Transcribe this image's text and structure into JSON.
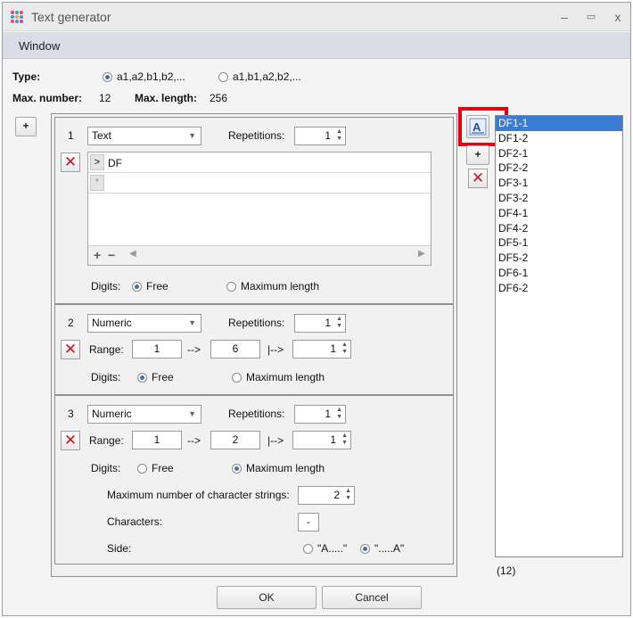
{
  "window": {
    "title": "Text generator",
    "minimize": "–",
    "maximize": "▭",
    "close": "x"
  },
  "menu": {
    "window": "Window"
  },
  "type": {
    "label": "Type:",
    "opt1": "a1,a2,b1,b2,...",
    "opt2": "a1,b1,a2,b2,...",
    "selected": "opt1"
  },
  "limits": {
    "max_number_label": "Max. number:",
    "max_number_value": "12",
    "max_length_label": "Max. length:",
    "max_length_value": "256"
  },
  "add_block_label": "+",
  "block1": {
    "index": "1",
    "type": "Text",
    "repetitions_label": "Repetitions:",
    "repetitions": "1",
    "texts": [
      {
        "marker": ">",
        "value": "DF"
      },
      {
        "marker": "*",
        "value": ""
      }
    ],
    "add": "+",
    "remove": "−",
    "digits_label": "Digits:",
    "free": "Free",
    "maximum_length": "Maximum length",
    "digits_selected": "free"
  },
  "block2": {
    "index": "2",
    "type": "Numeric",
    "repetitions_label": "Repetitions:",
    "repetitions": "1",
    "range_label": "Range:",
    "range_from": "1",
    "arrow1": "-->",
    "range_to": "6",
    "arrow2": "|-->",
    "step": "1",
    "digits_label": "Digits:",
    "free": "Free",
    "maximum_length": "Maximum length",
    "digits_selected": "free"
  },
  "block3": {
    "index": "3",
    "type": "Numeric",
    "repetitions_label": "Repetitions:",
    "repetitions": "1",
    "range_label": "Range:",
    "range_from": "1",
    "arrow1": "-->",
    "range_to": "2",
    "arrow2": "|-->",
    "step": "1",
    "digits_label": "Digits:",
    "free": "Free",
    "maximum_length": "Maximum length",
    "digits_selected": "maximum_length",
    "max_strings_label": "Maximum number of character strings:",
    "max_strings": "2",
    "characters_label": "Characters:",
    "characters": "-",
    "side_label": "Side:",
    "side_left": "\"A.....\"",
    "side_right": "\".....A\"",
    "side_selected": "right"
  },
  "preview": {
    "items": [
      "DF1-1",
      "DF1-2",
      "DF2-1",
      "DF2-2",
      "DF3-1",
      "DF3-2",
      "DF4-1",
      "DF4-2",
      "DF5-1",
      "DF5-2",
      "DF6-1",
      "DF6-2"
    ],
    "selected_index": 0,
    "count": "(12)"
  },
  "buttons": {
    "ok": "OK",
    "cancel": "Cancel"
  },
  "colors": {
    "highlight": "#e60012",
    "selection": "#3a7bd5",
    "delete": "#d0141e"
  }
}
